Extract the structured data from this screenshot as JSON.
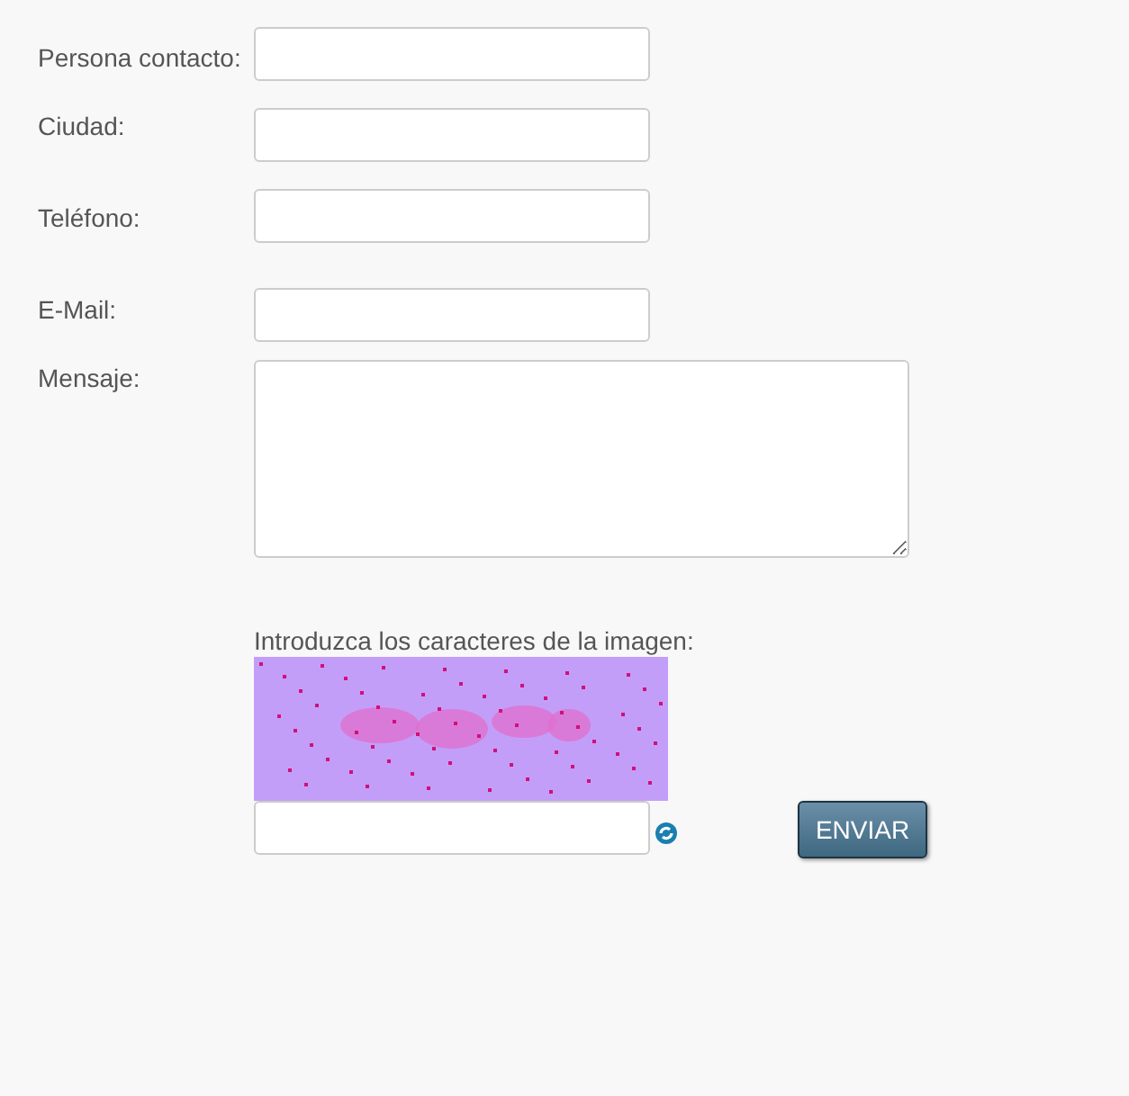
{
  "fields": [
    {
      "label": "Persona contacto:",
      "kind": "input"
    },
    {
      "label": "Ciudad:",
      "kind": "input"
    },
    {
      "label": "Teléfono:",
      "kind": "input"
    },
    {
      "label": "E-Mail:",
      "kind": "input"
    },
    {
      "label": "Mensaje:",
      "kind": "textarea"
    }
  ],
  "captcha": {
    "label": "Introduzca los caracteres de la imagen:"
  },
  "submit": "ENVIAR"
}
